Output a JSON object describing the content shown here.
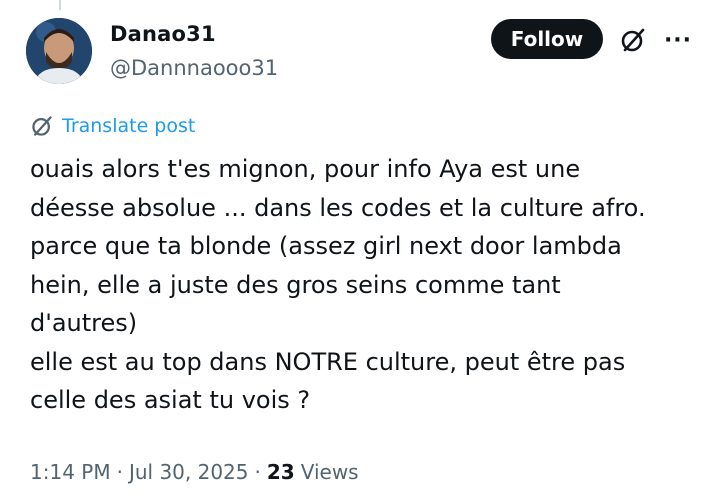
{
  "author": {
    "display_name": "Danao31",
    "handle": "@Dannnaooo31"
  },
  "actions": {
    "follow_label": "Follow",
    "more_label": "···"
  },
  "translate": {
    "label": "Translate post"
  },
  "post": {
    "lines": [
      "ouais alors t'es mignon, pour info Aya est une",
      "déesse absolue ... dans les codes et la culture afro.",
      "parce que ta blonde (assez girl next door lambda",
      "hein, elle a juste des gros seins comme tant",
      "d'autres)",
      "elle est au top dans NOTRE culture, peut être pas",
      "celle des asiat tu vois ?"
    ]
  },
  "meta": {
    "time": "1:14 PM",
    "separator_1": "·",
    "date": "Jul 30, 2025",
    "separator_2": "·",
    "views_count": "23",
    "views_label": "Views"
  },
  "colors": {
    "link": "#1d9bf0",
    "secondary_text": "#536471",
    "primary_text": "#0f1419",
    "follow_bg": "#0f1419"
  },
  "icons": {
    "grok": "grok-icon",
    "more": "more-icon",
    "translate": "translate-icon"
  }
}
